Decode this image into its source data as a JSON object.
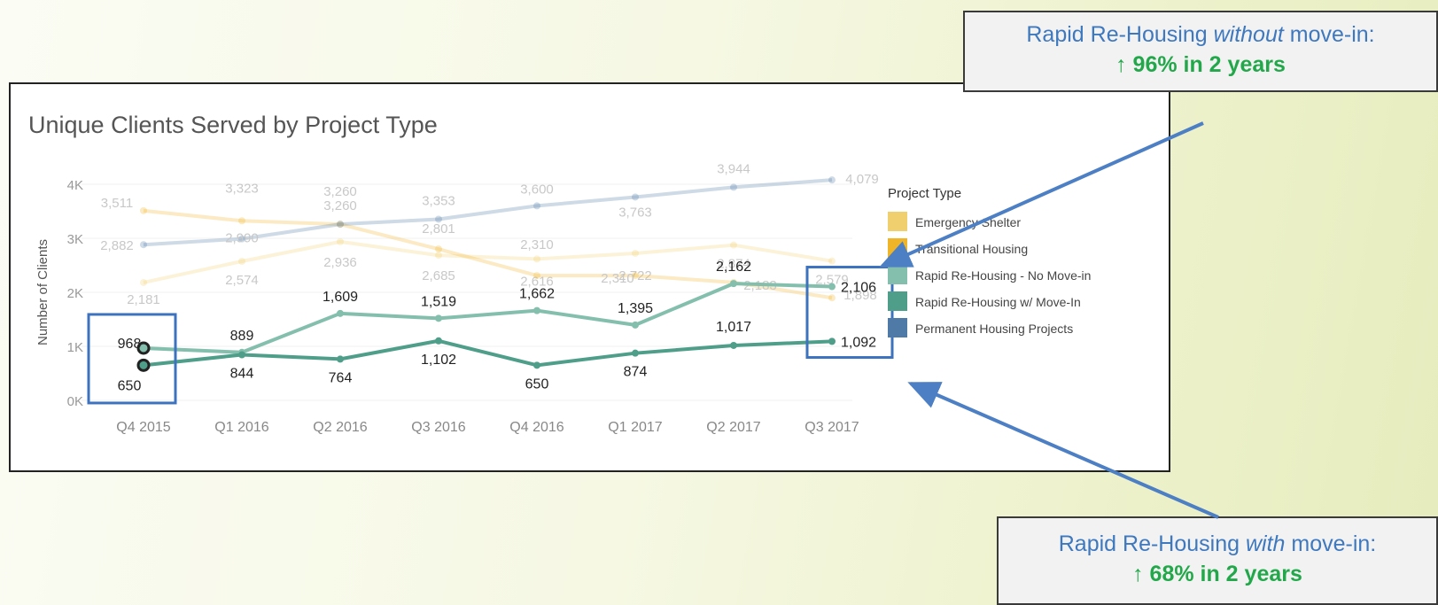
{
  "callouts": {
    "top": {
      "prefix": "Rapid Re-Housing ",
      "emph": "without",
      "suffix": " move-in:",
      "change": "↑ 96% in 2 years"
    },
    "bottom": {
      "prefix": "Rapid Re-Housing ",
      "emph": "with",
      "suffix": " move-in:",
      "change": "↑ 68% in 2 years"
    }
  },
  "colors": {
    "emergency_shelter": "#f0cf6e",
    "transitional_housing": "#f0b429",
    "rrh_no_move_in": "#84bfad",
    "rrh_move_in": "#4e9e8a",
    "permanent_housing": "#4f79a6",
    "highlight_box": "#3d72bf",
    "callout_text": "#3e78be",
    "callout_change": "#22a84a"
  },
  "chart_data": {
    "type": "line",
    "title": "Unique Clients Served by Project Type",
    "ylabel": "Number of Clients",
    "xlabel": "",
    "ylim": [
      0,
      4300
    ],
    "yticks": [
      0,
      1000,
      2000,
      3000,
      4000
    ],
    "ytick_labels": [
      "0K",
      "1K",
      "2K",
      "3K",
      "4K"
    ],
    "categories": [
      "Q4 2015",
      "Q1 2016",
      "Q2 2016",
      "Q3 2016",
      "Q4 2016",
      "Q1 2017",
      "Q2 2017",
      "Q3 2017"
    ],
    "legend_title": "Project Type",
    "legend_position": "right",
    "series": [
      {
        "name": "Emergency Shelter",
        "color": "#f0cf6e",
        "faded": true,
        "values": [
          2181,
          2574,
          2936,
          2685,
          2616,
          2722,
          2874,
          2579
        ]
      },
      {
        "name": "Transitional Housing",
        "color": "#f0b429",
        "faded": true,
        "values": [
          3511,
          3323,
          3260,
          2801,
          2310,
          2310,
          2183,
          1898
        ]
      },
      {
        "name": "Rapid Re-Housing - No Move-in",
        "color": "#84bfad",
        "faded": false,
        "values": [
          968,
          889,
          1609,
          1519,
          1662,
          1395,
          2162,
          2106
        ]
      },
      {
        "name": "Rapid Re-Housing w/ Move-In",
        "color": "#4e9e8a",
        "faded": false,
        "values": [
          650,
          844,
          764,
          1102,
          650,
          874,
          1017,
          1092
        ]
      },
      {
        "name": "Permanent Housing Projects",
        "color": "#4f79a6",
        "faded": true,
        "values": [
          2882,
          2990,
          3260,
          3353,
          3600,
          3763,
          3944,
          4079
        ]
      }
    ]
  }
}
